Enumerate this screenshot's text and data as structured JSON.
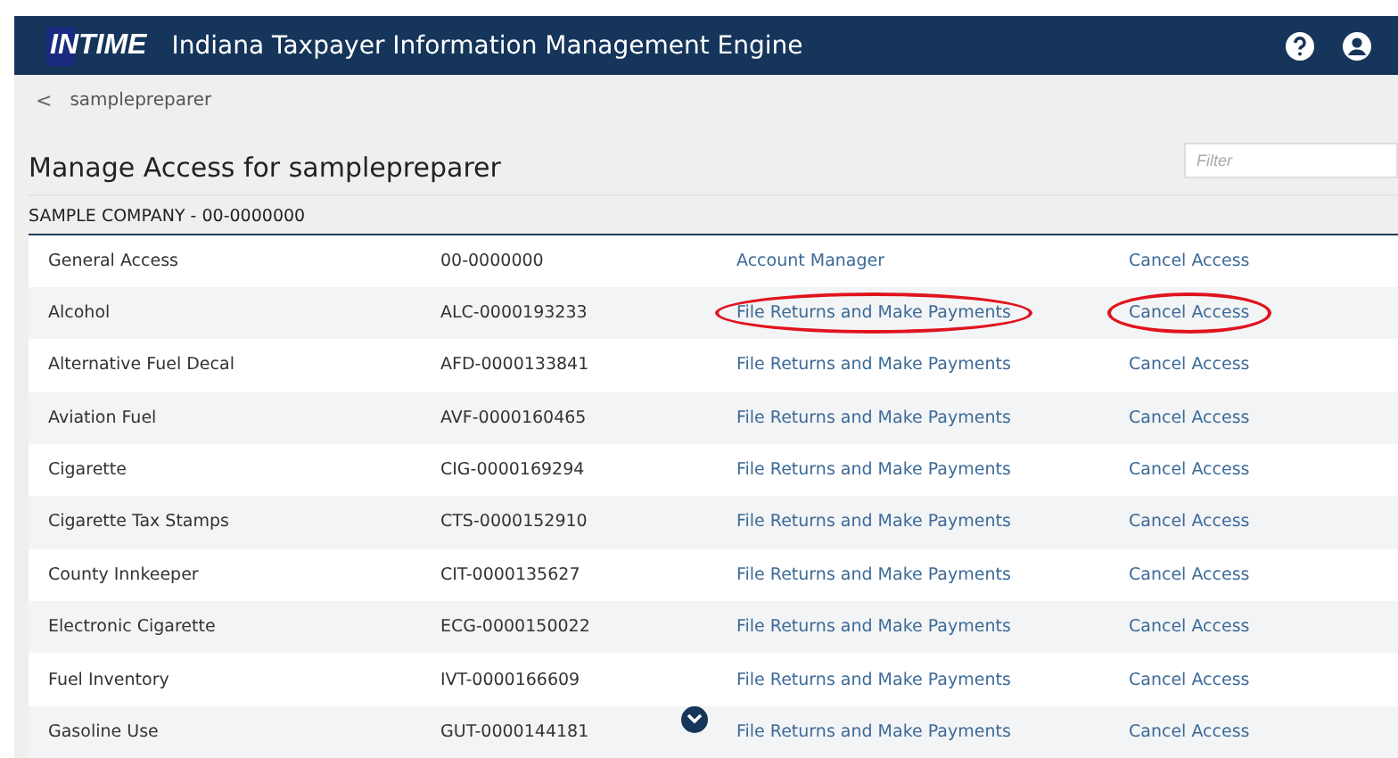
{
  "header": {
    "logo": "INTIME",
    "title": "Indiana Taxpayer Information Management Engine"
  },
  "breadcrumb": {
    "back": "<",
    "label": "samplepreparer"
  },
  "page_title": "Manage Access for samplepreparer",
  "filter": {
    "placeholder": "Filter"
  },
  "company": "SAMPLE COMPANY - 00-0000000",
  "rows": [
    {
      "account": "General Access",
      "id": "00-0000000",
      "access": "Account Manager",
      "action": "Cancel Access",
      "access_circled": false,
      "action_circled": false
    },
    {
      "account": "Alcohol",
      "id": "ALC-0000193233",
      "access": "File Returns and Make Payments",
      "action": "Cancel Access",
      "access_circled": true,
      "action_circled": true
    },
    {
      "account": "Alternative Fuel Decal",
      "id": "AFD-0000133841",
      "access": "File Returns and Make Payments",
      "action": "Cancel Access",
      "access_circled": false,
      "action_circled": false
    },
    {
      "account": "Aviation Fuel",
      "id": "AVF-0000160465",
      "access": "File Returns and Make Payments",
      "action": "Cancel Access",
      "access_circled": false,
      "action_circled": false
    },
    {
      "account": "Cigarette",
      "id": "CIG-0000169294",
      "access": "File Returns and Make Payments",
      "action": "Cancel Access",
      "access_circled": false,
      "action_circled": false
    },
    {
      "account": "Cigarette Tax Stamps",
      "id": "CTS-0000152910",
      "access": "File Returns and Make Payments",
      "action": "Cancel Access",
      "access_circled": false,
      "action_circled": false
    },
    {
      "account": "County Innkeeper",
      "id": "CIT-0000135627",
      "access": "File Returns and Make Payments",
      "action": "Cancel Access",
      "access_circled": false,
      "action_circled": false
    },
    {
      "account": "Electronic Cigarette",
      "id": "ECG-0000150022",
      "access": "File Returns and Make Payments",
      "action": "Cancel Access",
      "access_circled": false,
      "action_circled": false
    },
    {
      "account": "Fuel Inventory",
      "id": "IVT-0000166609",
      "access": "File Returns and Make Payments",
      "action": "Cancel Access",
      "access_circled": false,
      "action_circled": false
    },
    {
      "account": "Gasoline Use",
      "id": "GUT-0000144181",
      "access": "File Returns and Make Payments",
      "action": "Cancel Access",
      "access_circled": false,
      "action_circled": false
    }
  ]
}
